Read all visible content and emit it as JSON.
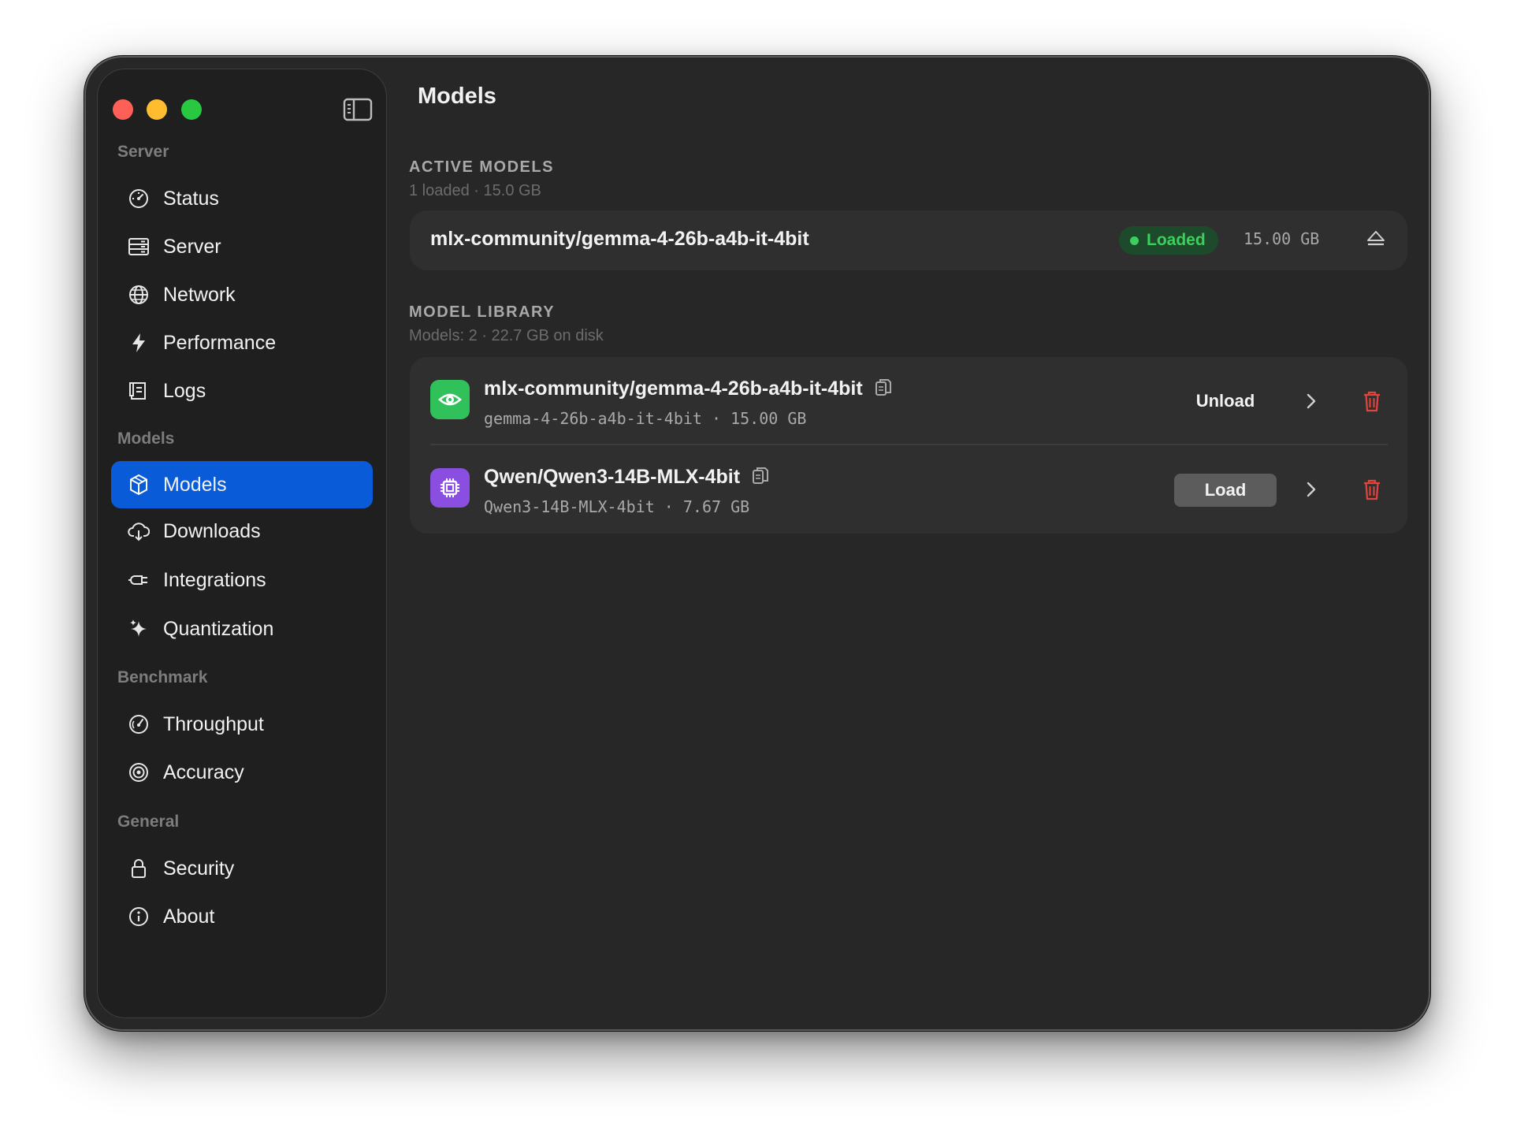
{
  "window": {
    "title": "Models"
  },
  "sidebar": {
    "sections": [
      {
        "title": "Server",
        "items": [
          {
            "label": "Status",
            "icon": "gauge-icon"
          },
          {
            "label": "Server",
            "icon": "server-icon"
          },
          {
            "label": "Network",
            "icon": "globe-icon"
          },
          {
            "label": "Performance",
            "icon": "bolt-icon"
          },
          {
            "label": "Logs",
            "icon": "scroll-icon"
          }
        ]
      },
      {
        "title": "Models",
        "items": [
          {
            "label": "Models",
            "icon": "cube-icon",
            "active": true
          },
          {
            "label": "Downloads",
            "icon": "cloud-download-icon"
          },
          {
            "label": "Integrations",
            "icon": "plug-icon"
          },
          {
            "label": "Quantization",
            "icon": "sparkles-icon"
          }
        ]
      },
      {
        "title": "Benchmark",
        "items": [
          {
            "label": "Throughput",
            "icon": "speedometer-icon"
          },
          {
            "label": "Accuracy",
            "icon": "target-icon"
          }
        ]
      },
      {
        "title": "General",
        "items": [
          {
            "label": "Security",
            "icon": "lock-icon"
          },
          {
            "label": "About",
            "icon": "info-icon"
          }
        ]
      }
    ]
  },
  "active_models": {
    "title": "ACTIVE MODELS",
    "subtitle": "1 loaded · 15.0 GB",
    "items": [
      {
        "name": "mlx-community/gemma-4-26b-a4b-it-4bit",
        "status": "Loaded",
        "size": "15.00 GB"
      }
    ]
  },
  "model_library": {
    "title": "MODEL LIBRARY",
    "subtitle": "Models: 2 · 22.7 GB on disk",
    "items": [
      {
        "name": "mlx-community/gemma-4-26b-a4b-it-4bit",
        "meta": "gemma-4-26b-a4b-it-4bit · 15.00 GB",
        "action": "Unload",
        "icon": "eye-icon",
        "icon_color": "#30c15a"
      },
      {
        "name": "Qwen/Qwen3-14B-MLX-4bit",
        "meta": "Qwen3-14B-MLX-4bit · 7.67 GB",
        "action": "Load",
        "icon": "chip-icon",
        "icon_color": "#8a4fe0"
      }
    ]
  },
  "colors": {
    "accent": "#0a5bd8",
    "loaded_green": "#3ccf5e",
    "delete_red": "#e5443a"
  }
}
